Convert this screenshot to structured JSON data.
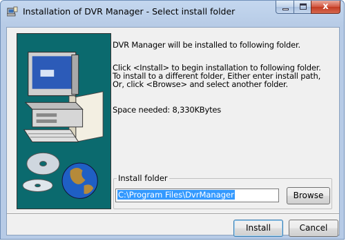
{
  "window": {
    "title": "Installation of DVR Manager - Select install folder",
    "controls": {
      "close_glyph": "x"
    }
  },
  "content": {
    "heading": "DVR Manager will be installed to following folder.",
    "instructions": [
      "Click <Install> to begin installation to following folder.",
      "To install to a different folder, Either enter install path,",
      "Or, click <Browse> and select another folder."
    ],
    "space_needed": "Space needed: 8,330KBytes"
  },
  "install_folder": {
    "label": "Install folder",
    "path": "C:\\Program Files\\DvrManager",
    "browse_label": "Browse"
  },
  "buttons": {
    "install_label": "Install",
    "cancel_label": "Cancel"
  }
}
